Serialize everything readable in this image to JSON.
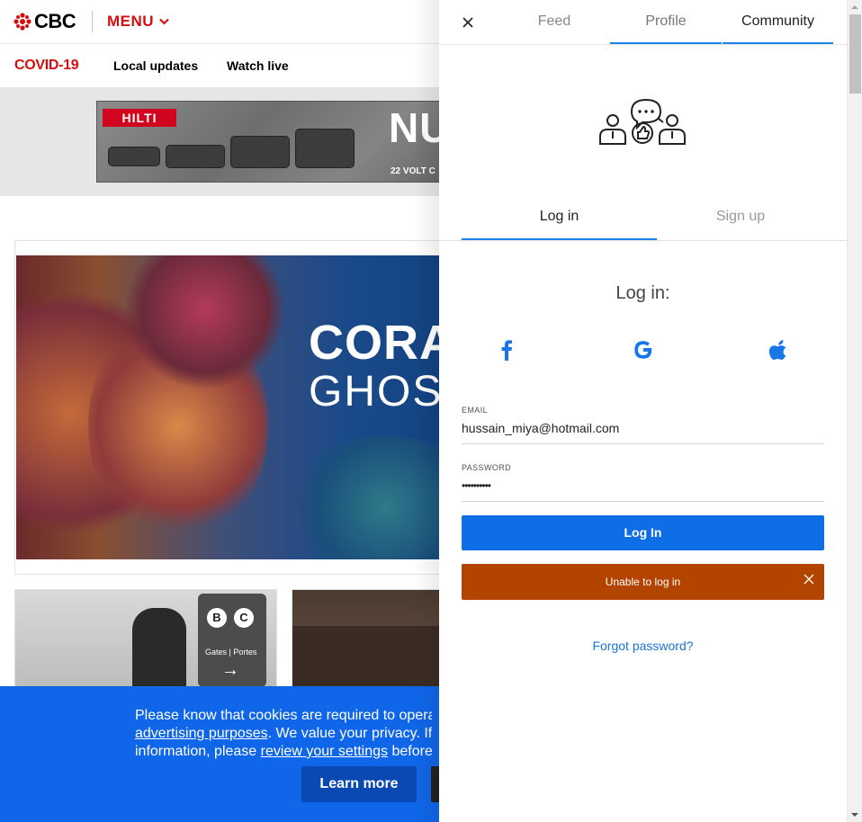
{
  "header": {
    "logo_text": "CBC",
    "menu_label": "MENU"
  },
  "subnav": {
    "covid_label": "COVID-19",
    "links": [
      "Local updates",
      "Watch live"
    ]
  },
  "ad": {
    "brand": "HILTI",
    "headline": "NU",
    "subline": "22 VOLT C"
  },
  "feature": {
    "title_line1": "CORA",
    "title_line2": "GHOS"
  },
  "thumb1": {
    "gate_left": "B",
    "gate_right": "C",
    "gate_text": "Gates | Portes"
  },
  "cookie_banner": {
    "line1": "Please know that cookies are required to operate",
    "line2_link": "advertising purposes",
    "line2_rest": ". We value your privacy. If yo",
    "line3_start": "information, please ",
    "line3_link": "review your settings",
    "line3_rest": " before c",
    "learn_more": "Learn more"
  },
  "panel": {
    "tabs": [
      {
        "label": "Feed"
      },
      {
        "label": "Profile"
      },
      {
        "label": "Community"
      }
    ],
    "auth_tabs": {
      "login": "Log in",
      "signup": "Sign up"
    },
    "login_heading": "Log in:",
    "social_icons": [
      "facebook-icon",
      "google-icon",
      "apple-icon"
    ],
    "email": {
      "label": "EMAIL",
      "value": "hussain_miya@hotmail.com"
    },
    "password": {
      "label": "PASSWORD",
      "value": "••••••••••"
    },
    "login_button": "Log In",
    "error_message": "Unable to log in",
    "forgot_password": "Forgot password?"
  },
  "colors": {
    "cbc_red": "#d50f10",
    "accent_blue": "#1a82e8",
    "button_blue": "#0d6ee6",
    "error_orange": "#b34400",
    "cookie_blue": "#1066e8"
  }
}
